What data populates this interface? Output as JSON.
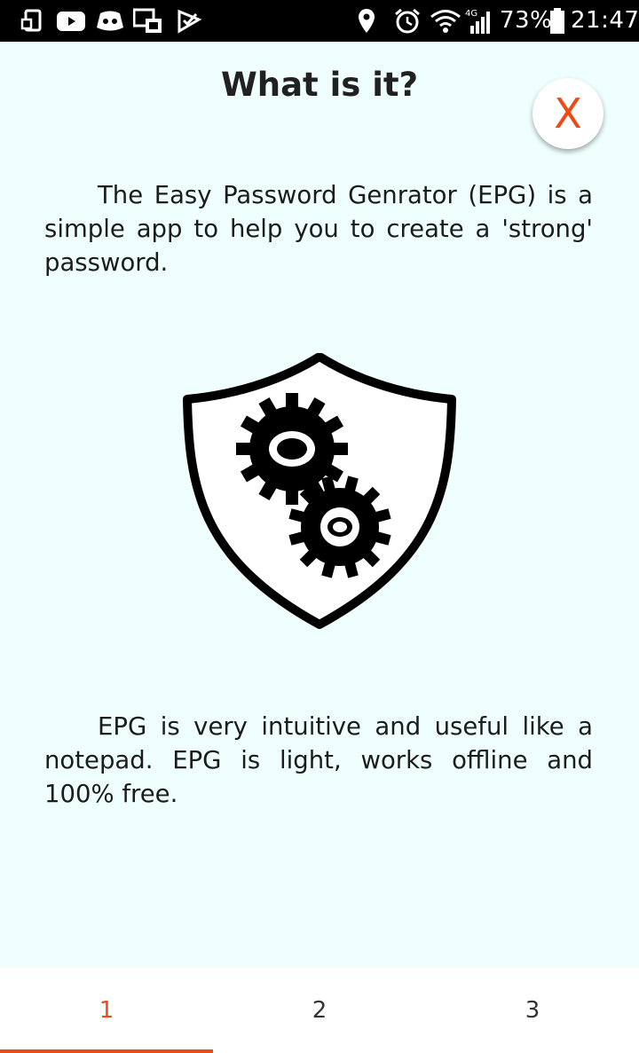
{
  "status_bar": {
    "battery": "73%",
    "time": "21:47",
    "network": "4G",
    "icons": [
      "screen-cast-icon",
      "youtube-icon",
      "discord-icon",
      "messenger-icon",
      "check-app-icon",
      "location-icon",
      "alarm-icon",
      "wifi-icon",
      "signal-icon",
      "battery-icon"
    ]
  },
  "page": {
    "title": "What is it?",
    "close_label": "X",
    "intro": "The Easy Password Genrator (EPG) is a simple app to help you to create a 'strong' password.",
    "description": "EPG is very intuitive and useful like a notepad. EPG is light, works offline and 100% free.",
    "illustration": "shield-gears-icon"
  },
  "tabs": [
    {
      "label": "1",
      "active": true
    },
    {
      "label": "2",
      "active": false
    },
    {
      "label": "3",
      "active": false
    }
  ],
  "colors": {
    "accent": "#ee4a16",
    "background": "#effffe",
    "status_bar": "#000000"
  }
}
